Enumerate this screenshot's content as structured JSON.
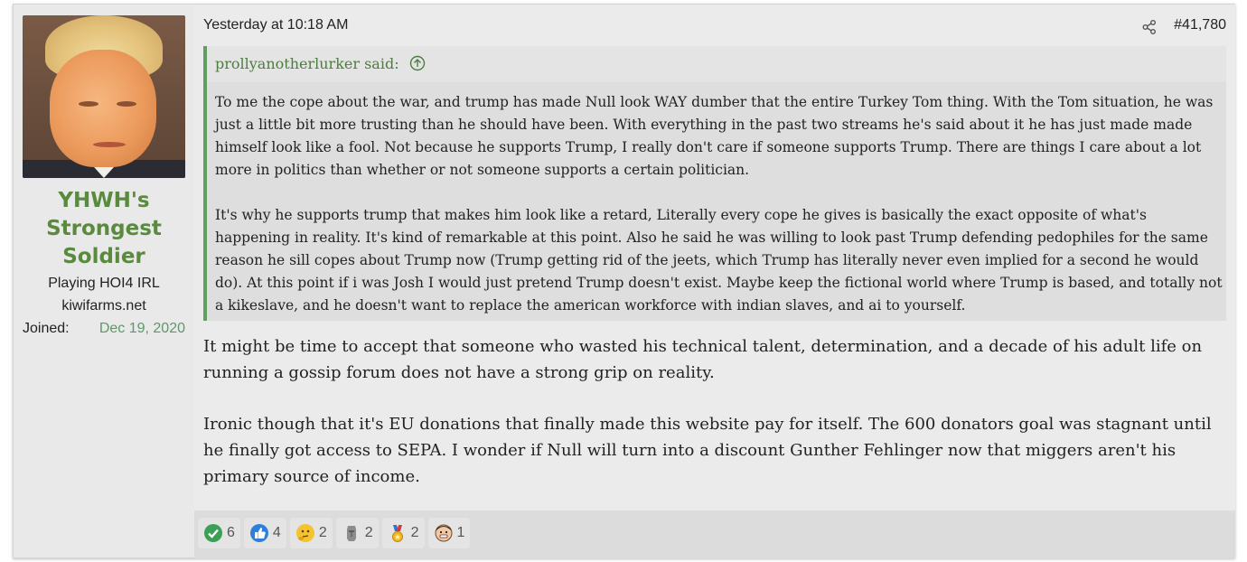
{
  "user": {
    "avatar_icon": "user-avatar",
    "name": "YHWH's Strongest Soldier",
    "name_lines": [
      "YHWH's",
      "Strongest",
      "Soldier"
    ],
    "title": "Playing HOI4 IRL",
    "site": "kiwifarms.net",
    "joined_label": "Joined:",
    "joined_date": "Dec 19, 2020"
  },
  "post": {
    "date": "Yesterday at 10:18 AM",
    "number": "#41,780",
    "quote": {
      "author": "prollyanotherlurker said:",
      "paragraphs": [
        "To me the cope about the war, and trump has made Null look WAY dumber that the entire Turkey Tom thing. With the Tom situation, he was just a little bit more trusting than he should have been. With everything in the past two streams he's said about it he has just made made himself look like a fool. Not because he supports Trump, I really don't care if someone supports Trump. There are things I care about a lot more in politics than whether or not someone supports a certain politician.",
        "It's why he supports trump that makes him look like a retard, Literally every cope he gives is basically the exact opposite of what's happening in reality. It's kind of remarkable at this point. Also he said he was willing to look past Trump defending pedophiles for the same reason he sill copes about Trump now (Trump getting rid of the jeets, which Trump has literally never even implied for a second he would do). At this point if i was Josh I would just pretend Trump doesn't exist. Maybe keep the fictional world where Trump is based, and totally not a kikeslave, and he doesn't want to replace the american workforce with indian slaves, and ai to yourself."
      ]
    },
    "body": [
      "It might be time to accept that someone who wasted his technical talent, determination, and a decade of his adult life on running a gossip forum does not have a strong grip on reality.",
      "Ironic though that it's EU donations that finally made this website pay for itself. The 600 donators goal was stagnant until he finally got access to SEPA. I wonder if Null will turn into a discount Gunther Fehlinger now that miggers aren't his primary source of income."
    ]
  },
  "reactions": [
    {
      "icon": "checkmark-icon",
      "count": "6"
    },
    {
      "icon": "thumbs-up-icon",
      "count": "4"
    },
    {
      "icon": "thinking-face-icon",
      "count": "2"
    },
    {
      "icon": "moai-icon",
      "count": "2"
    },
    {
      "icon": "medal-icon",
      "count": "2"
    },
    {
      "icon": "grinning-man-icon",
      "count": "1"
    }
  ],
  "colors": {
    "username": "#5a8a3e",
    "joined_date": "#5a9a68",
    "quote_border": "#5fa060",
    "quote_author": "#4d7d3e"
  }
}
